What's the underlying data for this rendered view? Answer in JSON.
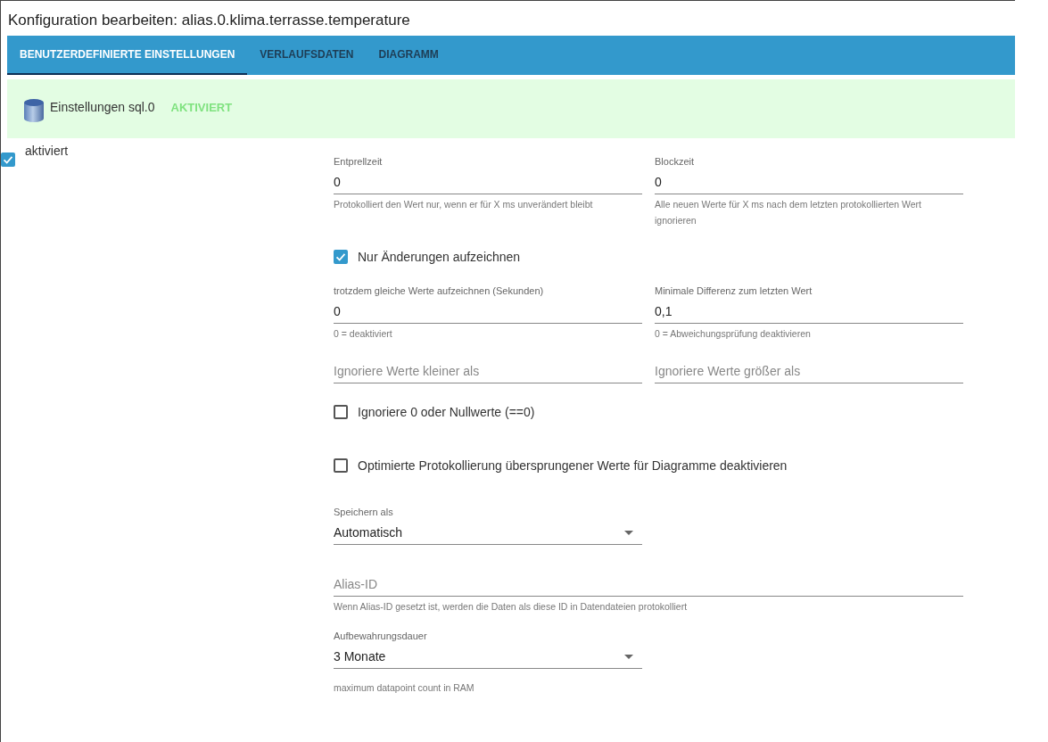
{
  "window": {
    "title": "Konfiguration bearbeiten: alias.0.klima.terrasse.temperature"
  },
  "tabs": [
    {
      "label": "BENUTZERDEFINIERTE EINSTELLUNGEN",
      "selected": true
    },
    {
      "label": "VERLAUFSDATEN",
      "selected": false
    },
    {
      "label": "DIAGRAMM",
      "selected": false
    }
  ],
  "instance": {
    "title": "Einstellungen sql.0",
    "status": "AKTIVIERT"
  },
  "enabled": {
    "label": "aktiviert",
    "checked": true
  },
  "form": [
    {
      "kind": "pair",
      "fields": [
        {
          "label": "Entprellzeit",
          "value": "0",
          "helper": "Protokolliert den Wert nur, wenn er für X ms unverändert bleibt"
        },
        {
          "label": "Blockzeit",
          "value": "0",
          "helper": "Alle neuen Werte für X ms nach dem letzten protokollierten Wert ignorieren"
        }
      ]
    },
    {
      "kind": "checkbox",
      "label": "Nur Änderungen aufzeichnen",
      "checked": true
    },
    {
      "kind": "pair",
      "fields": [
        {
          "label": "trotzdem gleiche Werte aufzeichnen (Sekunden)",
          "value": "0",
          "helper": "0 = deaktiviert"
        },
        {
          "label": "Minimale Differenz zum letzten Wert",
          "value": "0,1",
          "helper": "0 = Abweichungsprüfung deaktivieren"
        }
      ]
    },
    {
      "kind": "pair",
      "fields": [
        {
          "placeholder": "Ignoriere Werte kleiner als"
        },
        {
          "placeholder": "Ignoriere Werte größer als"
        }
      ]
    },
    {
      "kind": "checkbox",
      "label": "Ignoriere 0 oder Nullwerte (==0)",
      "checked": false
    },
    {
      "kind": "checkbox",
      "label": "Optimierte Protokollierung übersprungener Werte für Diagramme deaktivieren",
      "checked": false
    },
    {
      "kind": "select",
      "label": "Speichern als",
      "value": "Automatisch"
    },
    {
      "kind": "field",
      "placeholder": "Alias-ID",
      "helper": "Wenn Alias-ID gesetzt ist, werden die Daten als diese ID in Datendateien protokolliert"
    },
    {
      "kind": "select",
      "label": "Aufbewahrungsdauer",
      "value": "3 Monate"
    },
    {
      "kind": "note",
      "label": "maximum datapoint count in RAM"
    }
  ]
}
